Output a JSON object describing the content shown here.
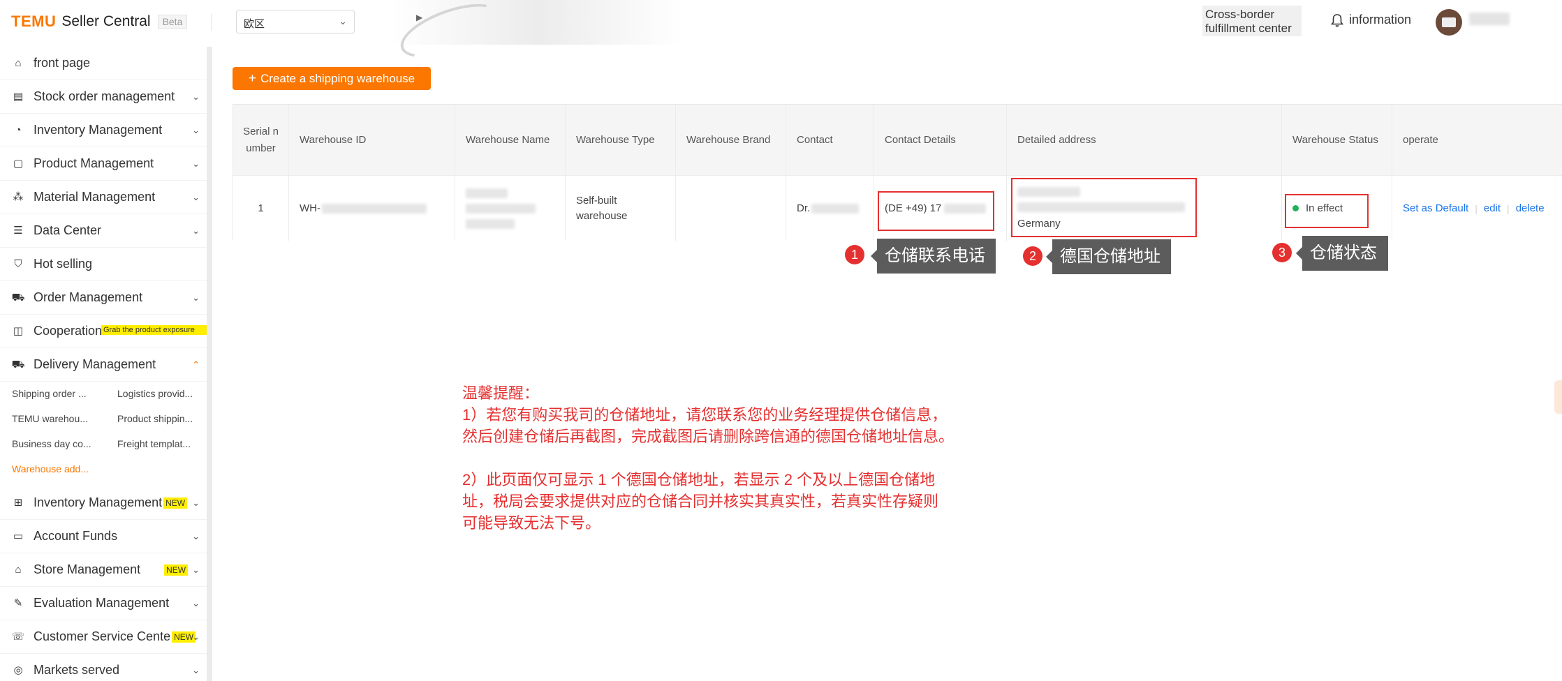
{
  "header": {
    "logo_brand": "TEMU",
    "logo_product": "Seller Central",
    "beta": "Beta",
    "region": "欧区",
    "cross_border": "Cross-border fulfillment center",
    "info_label": "information"
  },
  "sidebar": {
    "items": [
      {
        "label": "front page",
        "icon": "home-icon"
      },
      {
        "label": "Stock order management",
        "icon": "clipboard-icon"
      },
      {
        "label": "Inventory Management",
        "icon": "inventory-icon"
      },
      {
        "label": "Product Management",
        "icon": "product-icon"
      },
      {
        "label": "Material Management",
        "icon": "material-icon"
      },
      {
        "label": "Data Center",
        "icon": "data-icon"
      },
      {
        "label": "Hot selling",
        "icon": "cart-icon"
      },
      {
        "label": "Order Management",
        "icon": "order-icon"
      },
      {
        "label": "Cooperation",
        "icon": "cooperation-icon",
        "promo": "Grab the product exposure"
      },
      {
        "label": "Delivery Management",
        "icon": "truck-icon"
      },
      {
        "label": "Inventory Management",
        "icon": "inventory-add-icon",
        "badge": "NEW"
      },
      {
        "label": "Account Funds",
        "icon": "funds-icon"
      },
      {
        "label": "Store Management",
        "icon": "store-icon",
        "badge": "NEW"
      },
      {
        "label": "Evaluation Management",
        "icon": "evaluation-icon"
      },
      {
        "label": "Customer Service Cente",
        "icon": "service-icon",
        "badge": "NEW"
      },
      {
        "label": "Markets served",
        "icon": "markets-icon"
      }
    ],
    "delivery_sub": [
      "Shipping order ...",
      "Logistics provid...",
      "TEMU warehou...",
      "Product shippin...",
      "Business day co...",
      "Freight templat...",
      "Warehouse add..."
    ]
  },
  "create_button": "Create a shipping warehouse",
  "table": {
    "columns": [
      "Serial number",
      "Warehouse ID",
      "Warehouse Name",
      "Warehouse Type",
      "Warehouse Brand",
      "Contact",
      "Contact Details",
      "Detailed address",
      "Warehouse Status",
      "operate"
    ],
    "row": {
      "serial": "1",
      "warehouse_id": "WH-",
      "warehouse_type": "Self-built warehouse",
      "contact": "Dr.",
      "contact_details": "(DE +49) 17",
      "address_country": "Germany",
      "status": "In effect",
      "ops": [
        "Set as Default",
        "edit",
        "delete"
      ]
    }
  },
  "annotations": [
    {
      "num": "1",
      "label": "仓储联系电话"
    },
    {
      "num": "2",
      "label": "德国仓储地址"
    },
    {
      "num": "3",
      "label": "仓储状态"
    }
  ],
  "notice": {
    "title": "温馨提醒：",
    "line1": "1）若您有购买我司的仓储地址，请您联系您的业务经理提供仓储信息，",
    "line2": "然后创建仓储后再截图，完成截图后请删除跨信通的德国仓储地址信息。",
    "line3": "2）此页面仅可显示 1 个德国仓储地址，若显示 2 个及以上德国仓储地",
    "line4": "址，税局会要求提供对应的仓储合同并核实其真实性，若真实性存疑则",
    "line5": "可能导致无法下号。"
  },
  "colors": {
    "brand": "#fb7701",
    "annotation": "#e53030",
    "link": "#1a73e8",
    "status": "#20b15a"
  }
}
